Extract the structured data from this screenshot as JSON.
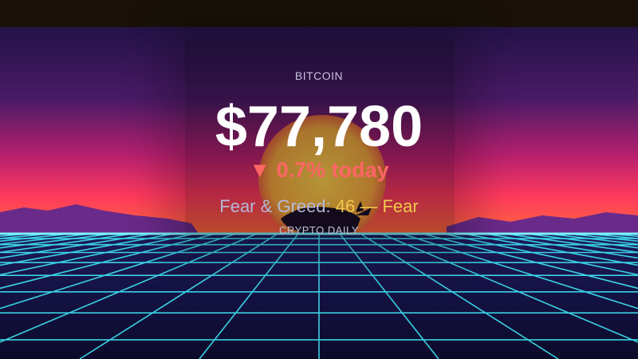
{
  "asset": {
    "label": "BITCOIN"
  },
  "price": {
    "value": "$77,780"
  },
  "change": {
    "arrow": "▼",
    "text": "0.7% today"
  },
  "sentiment": {
    "label": "Fear & Greed:",
    "value": "46 — Fear"
  },
  "brand": {
    "name": "CRYPTO DAILY"
  },
  "colors": {
    "negative": "#ff6565",
    "sentiment_value": "#f2c94c",
    "grid_lines": "#3fe6f5",
    "sky_top": "#2a1656",
    "horizon": "#ff3b6a",
    "sun": "#f5d23a"
  }
}
